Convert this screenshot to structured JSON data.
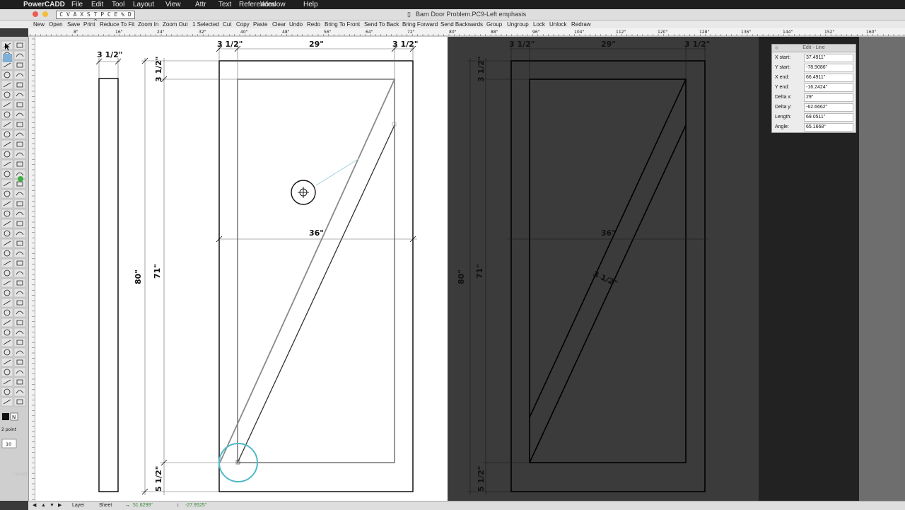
{
  "menubar": {
    "app": "PowerCADD",
    "items": [
      "File",
      "Edit",
      "Tool",
      "Layout",
      "View",
      "Attr",
      "Text",
      "References",
      "Window",
      "Help"
    ]
  },
  "window": {
    "title": "Barn Door Problem.PC9-Left emphasis",
    "boxes": [
      "C",
      "V",
      "A",
      "X",
      "S",
      "T",
      "P",
      "C",
      "E",
      "%",
      "D",
      "O"
    ]
  },
  "toolbar": {
    "items": [
      "New",
      "Open",
      "Save",
      "Print",
      "Reduce To Fit",
      "Zoom In",
      "Zoom Out",
      "1 Selected",
      "Cut",
      "Copy",
      "Paste",
      "Clear",
      "Undo",
      "Redo",
      "Bring To Front",
      "Send To Back",
      "Bring Forward",
      "Send Backwards",
      "Group",
      "Ungroup",
      "Lock",
      "Unlock",
      "Redraw"
    ]
  },
  "ruler": {
    "labels": [
      "8\"",
      "16\"",
      "24\"",
      "32\"",
      "40\"",
      "48\"",
      "56\"",
      "64\"",
      "72\"",
      "80\"",
      "88\"",
      "96\"",
      "104\"",
      "112\"",
      "120\"",
      "128\"",
      "136\"",
      "144\"",
      "152\"",
      "160\""
    ]
  },
  "palette": {
    "line_weight": "2 point",
    "field_value": "10",
    "location_label": "Locati"
  },
  "edit_panel": {
    "title": "Edit - Line",
    "fields": [
      {
        "label": "X start:",
        "value": "37.4911\""
      },
      {
        "label": "Y start:",
        "value": "-78.9086\""
      },
      {
        "label": "X end:",
        "value": "66.4911\""
      },
      {
        "label": "Y end:",
        "value": "-16.2424\""
      },
      {
        "label": "Delta x:",
        "value": "29\""
      },
      {
        "label": "Delta y:",
        "value": "-62.6662\""
      },
      {
        "label": "Length:",
        "value": "69.0511\""
      },
      {
        "label": "Angle:",
        "value": "65.1668°"
      }
    ]
  },
  "drawing_left": {
    "dim_stile_width": "3 1/2\"",
    "dim_top_left": "3 1/2\"",
    "dim_top_mid": "29\"",
    "dim_top_right": "3 1/2\"",
    "dim_side_top": "3 1/2\"",
    "dim_overall_height": "80\"",
    "dim_inner_height": "71\"",
    "dim_width": "36\"",
    "dim_side_bottom": "5 1/2\""
  },
  "drawing_right": {
    "dim_top_left": "3 1/2\"",
    "dim_top_mid": "29\"",
    "dim_top_right": "3 1/2\"",
    "dim_side_top": "3 1/2\"",
    "dim_overall_height": "80\"",
    "dim_inner_height": "71\"",
    "dim_width": "36\"",
    "dim_brace": "3 1/2\"",
    "dim_side_bottom": "5 1/2\""
  },
  "status": {
    "layer": "Layer",
    "sheet": "Sheet",
    "x_coord": "51.6299\"",
    "y_coord": "-27.9525\""
  },
  "colors": {
    "accent_circle": "#4fb8c9",
    "dark_canvas": "#3a3a3a"
  }
}
